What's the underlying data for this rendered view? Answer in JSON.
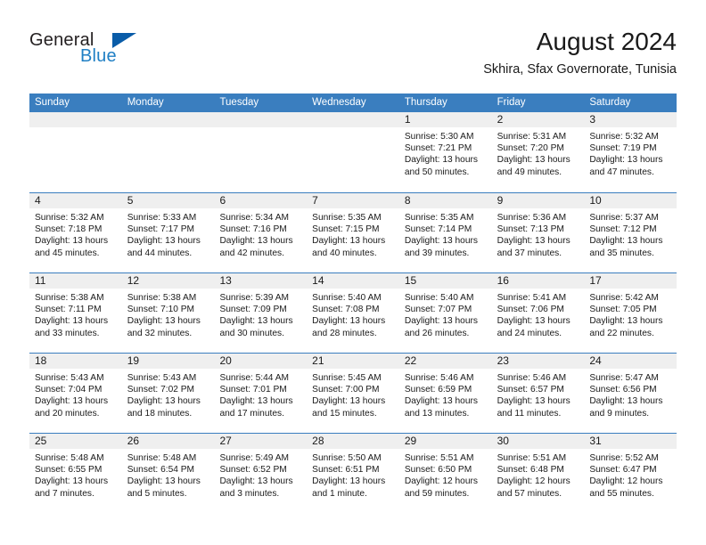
{
  "brand": {
    "name_part1": "General",
    "name_part2": "Blue",
    "triangle_icon": "triangle-icon"
  },
  "header": {
    "title": "August 2024",
    "subtitle": "Skhira, Sfax Governorate, Tunisia"
  },
  "colors": {
    "header_blue": "#3a7ebf",
    "brand_blue": "#1f7fc4",
    "logo_triangle": "#0a5ca8",
    "day_band": "#efefef"
  },
  "weekdays": [
    "Sunday",
    "Monday",
    "Tuesday",
    "Wednesday",
    "Thursday",
    "Friday",
    "Saturday"
  ],
  "weeks": [
    [
      {
        "empty": true
      },
      {
        "empty": true
      },
      {
        "empty": true
      },
      {
        "empty": true
      },
      {
        "day": "1",
        "l1": "Sunrise: 5:30 AM",
        "l2": "Sunset: 7:21 PM",
        "l3": "Daylight: 13 hours",
        "l4": "and 50 minutes."
      },
      {
        "day": "2",
        "l1": "Sunrise: 5:31 AM",
        "l2": "Sunset: 7:20 PM",
        "l3": "Daylight: 13 hours",
        "l4": "and 49 minutes."
      },
      {
        "day": "3",
        "l1": "Sunrise: 5:32 AM",
        "l2": "Sunset: 7:19 PM",
        "l3": "Daylight: 13 hours",
        "l4": "and 47 minutes."
      }
    ],
    [
      {
        "day": "4",
        "l1": "Sunrise: 5:32 AM",
        "l2": "Sunset: 7:18 PM",
        "l3": "Daylight: 13 hours",
        "l4": "and 45 minutes."
      },
      {
        "day": "5",
        "l1": "Sunrise: 5:33 AM",
        "l2": "Sunset: 7:17 PM",
        "l3": "Daylight: 13 hours",
        "l4": "and 44 minutes."
      },
      {
        "day": "6",
        "l1": "Sunrise: 5:34 AM",
        "l2": "Sunset: 7:16 PM",
        "l3": "Daylight: 13 hours",
        "l4": "and 42 minutes."
      },
      {
        "day": "7",
        "l1": "Sunrise: 5:35 AM",
        "l2": "Sunset: 7:15 PM",
        "l3": "Daylight: 13 hours",
        "l4": "and 40 minutes."
      },
      {
        "day": "8",
        "l1": "Sunrise: 5:35 AM",
        "l2": "Sunset: 7:14 PM",
        "l3": "Daylight: 13 hours",
        "l4": "and 39 minutes."
      },
      {
        "day": "9",
        "l1": "Sunrise: 5:36 AM",
        "l2": "Sunset: 7:13 PM",
        "l3": "Daylight: 13 hours",
        "l4": "and 37 minutes."
      },
      {
        "day": "10",
        "l1": "Sunrise: 5:37 AM",
        "l2": "Sunset: 7:12 PM",
        "l3": "Daylight: 13 hours",
        "l4": "and 35 minutes."
      }
    ],
    [
      {
        "day": "11",
        "l1": "Sunrise: 5:38 AM",
        "l2": "Sunset: 7:11 PM",
        "l3": "Daylight: 13 hours",
        "l4": "and 33 minutes."
      },
      {
        "day": "12",
        "l1": "Sunrise: 5:38 AM",
        "l2": "Sunset: 7:10 PM",
        "l3": "Daylight: 13 hours",
        "l4": "and 32 minutes."
      },
      {
        "day": "13",
        "l1": "Sunrise: 5:39 AM",
        "l2": "Sunset: 7:09 PM",
        "l3": "Daylight: 13 hours",
        "l4": "and 30 minutes."
      },
      {
        "day": "14",
        "l1": "Sunrise: 5:40 AM",
        "l2": "Sunset: 7:08 PM",
        "l3": "Daylight: 13 hours",
        "l4": "and 28 minutes."
      },
      {
        "day": "15",
        "l1": "Sunrise: 5:40 AM",
        "l2": "Sunset: 7:07 PM",
        "l3": "Daylight: 13 hours",
        "l4": "and 26 minutes."
      },
      {
        "day": "16",
        "l1": "Sunrise: 5:41 AM",
        "l2": "Sunset: 7:06 PM",
        "l3": "Daylight: 13 hours",
        "l4": "and 24 minutes."
      },
      {
        "day": "17",
        "l1": "Sunrise: 5:42 AM",
        "l2": "Sunset: 7:05 PM",
        "l3": "Daylight: 13 hours",
        "l4": "and 22 minutes."
      }
    ],
    [
      {
        "day": "18",
        "l1": "Sunrise: 5:43 AM",
        "l2": "Sunset: 7:04 PM",
        "l3": "Daylight: 13 hours",
        "l4": "and 20 minutes."
      },
      {
        "day": "19",
        "l1": "Sunrise: 5:43 AM",
        "l2": "Sunset: 7:02 PM",
        "l3": "Daylight: 13 hours",
        "l4": "and 18 minutes."
      },
      {
        "day": "20",
        "l1": "Sunrise: 5:44 AM",
        "l2": "Sunset: 7:01 PM",
        "l3": "Daylight: 13 hours",
        "l4": "and 17 minutes."
      },
      {
        "day": "21",
        "l1": "Sunrise: 5:45 AM",
        "l2": "Sunset: 7:00 PM",
        "l3": "Daylight: 13 hours",
        "l4": "and 15 minutes."
      },
      {
        "day": "22",
        "l1": "Sunrise: 5:46 AM",
        "l2": "Sunset: 6:59 PM",
        "l3": "Daylight: 13 hours",
        "l4": "and 13 minutes."
      },
      {
        "day": "23",
        "l1": "Sunrise: 5:46 AM",
        "l2": "Sunset: 6:57 PM",
        "l3": "Daylight: 13 hours",
        "l4": "and 11 minutes."
      },
      {
        "day": "24",
        "l1": "Sunrise: 5:47 AM",
        "l2": "Sunset: 6:56 PM",
        "l3": "Daylight: 13 hours",
        "l4": "and 9 minutes."
      }
    ],
    [
      {
        "day": "25",
        "l1": "Sunrise: 5:48 AM",
        "l2": "Sunset: 6:55 PM",
        "l3": "Daylight: 13 hours",
        "l4": "and 7 minutes."
      },
      {
        "day": "26",
        "l1": "Sunrise: 5:48 AM",
        "l2": "Sunset: 6:54 PM",
        "l3": "Daylight: 13 hours",
        "l4": "and 5 minutes."
      },
      {
        "day": "27",
        "l1": "Sunrise: 5:49 AM",
        "l2": "Sunset: 6:52 PM",
        "l3": "Daylight: 13 hours",
        "l4": "and 3 minutes."
      },
      {
        "day": "28",
        "l1": "Sunrise: 5:50 AM",
        "l2": "Sunset: 6:51 PM",
        "l3": "Daylight: 13 hours",
        "l4": "and 1 minute."
      },
      {
        "day": "29",
        "l1": "Sunrise: 5:51 AM",
        "l2": "Sunset: 6:50 PM",
        "l3": "Daylight: 12 hours",
        "l4": "and 59 minutes."
      },
      {
        "day": "30",
        "l1": "Sunrise: 5:51 AM",
        "l2": "Sunset: 6:48 PM",
        "l3": "Daylight: 12 hours",
        "l4": "and 57 minutes."
      },
      {
        "day": "31",
        "l1": "Sunrise: 5:52 AM",
        "l2": "Sunset: 6:47 PM",
        "l3": "Daylight: 12 hours",
        "l4": "and 55 minutes."
      }
    ]
  ]
}
